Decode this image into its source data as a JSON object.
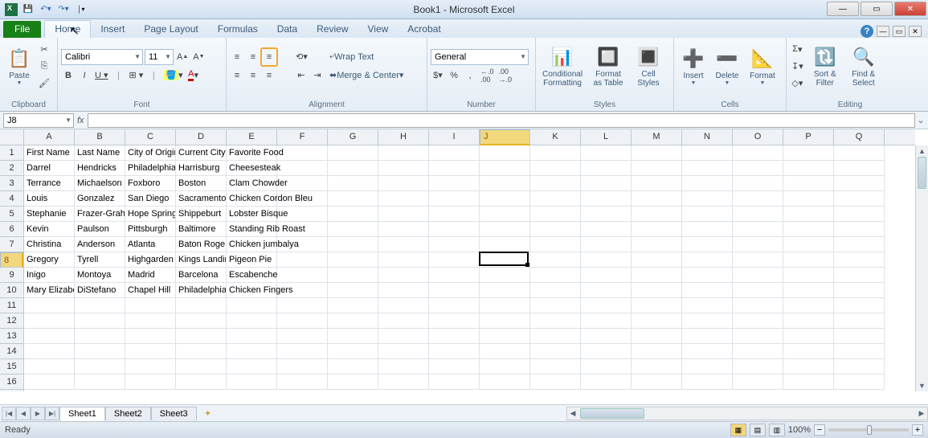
{
  "window_title": "Book1 - Microsoft Excel",
  "tabs": {
    "file": "File",
    "home": "Home",
    "insert": "Insert",
    "page_layout": "Page Layout",
    "formulas": "Formulas",
    "data": "Data",
    "review": "Review",
    "view": "View",
    "acrobat": "Acrobat"
  },
  "ribbon": {
    "clipboard": {
      "paste": "Paste",
      "label": "Clipboard"
    },
    "font": {
      "name": "Calibri",
      "size": "11",
      "label": "Font"
    },
    "alignment": {
      "wrap": "Wrap Text",
      "merge": "Merge & Center",
      "label": "Alignment"
    },
    "number": {
      "format": "General",
      "label": "Number",
      "dollar": "$",
      "percent": "%",
      "comma": ",",
      "inc_dec": ".0",
      "dec_dec": ".00"
    },
    "styles": {
      "cond": "Conditional\nFormatting",
      "table": "Format\nas Table",
      "cell": "Cell\nStyles",
      "label": "Styles"
    },
    "cells": {
      "insert": "Insert",
      "delete": "Delete",
      "format": "Format",
      "label": "Cells"
    },
    "editing": {
      "sort": "Sort &\nFilter",
      "find": "Find &\nSelect",
      "sum": "Σ",
      "fill": "↧",
      "clear": "◇",
      "label": "Editing"
    }
  },
  "namebox": "J8",
  "fx": "fx",
  "columns": [
    "A",
    "B",
    "C",
    "D",
    "E",
    "F",
    "G",
    "H",
    "I",
    "J",
    "K",
    "L",
    "M",
    "N",
    "O",
    "P",
    "Q"
  ],
  "rows_visible": 16,
  "active_cell": {
    "col": 9,
    "row": 8
  },
  "data_rows": [
    [
      "First Name",
      "Last Name",
      "City of Origin",
      "Current City",
      "Favorite Food"
    ],
    [
      "Darrel",
      "Hendricks",
      "Philadelphia",
      "Harrisburg",
      "Cheesesteak"
    ],
    [
      "Terrance",
      "Michaelson",
      "Foxboro",
      "Boston",
      "Clam Chowder"
    ],
    [
      "Louis",
      "Gonzalez",
      "San Diego",
      "Sacramento",
      "Chicken Cordon Bleu"
    ],
    [
      "Stephanie",
      "Frazer-Graham",
      "Hope Springs",
      "Shippeburt",
      "Lobster Bisque"
    ],
    [
      "Kevin",
      "Paulson",
      "Pittsburgh",
      "Baltimore",
      "Standing Rib Roast"
    ],
    [
      "Christina",
      "Anderson",
      "Atlanta",
      "Baton Roge",
      "Chicken jumbalya"
    ],
    [
      "Gregory",
      "Tyrell",
      "Highgarden",
      "Kings Landing",
      "Pigeon Pie"
    ],
    [
      "Inigo",
      "Montoya",
      "Madrid",
      "Barcelona",
      "Escabenche"
    ],
    [
      "Mary Elizabeth",
      "DiStefano",
      "Chapel Hill",
      "Philadelphia",
      "Chicken Fingers"
    ]
  ],
  "sheets": [
    "Sheet1",
    "Sheet2",
    "Sheet3"
  ],
  "status": {
    "ready": "Ready",
    "zoom": "100%"
  }
}
